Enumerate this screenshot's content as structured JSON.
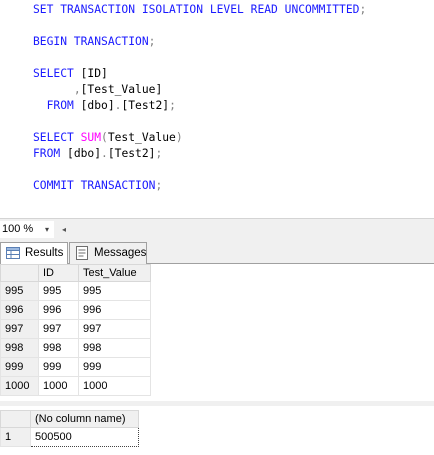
{
  "editor": {
    "lines": [
      [
        {
          "t": "kw",
          "v": "SET TRANSACTION ISOLATION LEVEL READ UNCOMMITTED"
        },
        {
          "t": "op",
          "v": ";"
        }
      ],
      [],
      [
        {
          "t": "kw",
          "v": "BEGIN TRANSACTION"
        },
        {
          "t": "op",
          "v": ";"
        }
      ],
      [],
      [
        {
          "t": "kw",
          "v": "SELECT "
        },
        {
          "t": "tx",
          "v": "[ID]"
        }
      ],
      [
        {
          "t": "tx",
          "v": "      "
        },
        {
          "t": "op",
          "v": ","
        },
        {
          "t": "tx",
          "v": "[Test_Value]"
        }
      ],
      [
        {
          "t": "tx",
          "v": "  "
        },
        {
          "t": "kw",
          "v": "FROM "
        },
        {
          "t": "tx",
          "v": "[dbo]"
        },
        {
          "t": "op",
          "v": "."
        },
        {
          "t": "tx",
          "v": "[Test2]"
        },
        {
          "t": "op",
          "v": ";"
        }
      ],
      [],
      [
        {
          "t": "kw",
          "v": "SELECT "
        },
        {
          "t": "fn",
          "v": "SUM"
        },
        {
          "t": "op",
          "v": "("
        },
        {
          "t": "tx",
          "v": "Test_Value"
        },
        {
          "t": "op",
          "v": ")"
        }
      ],
      [
        {
          "t": "kw",
          "v": "FROM "
        },
        {
          "t": "tx",
          "v": "[dbo]"
        },
        {
          "t": "op",
          "v": "."
        },
        {
          "t": "tx",
          "v": "[Test2]"
        },
        {
          "t": "op",
          "v": ";"
        }
      ],
      [],
      [
        {
          "t": "kw",
          "v": "COMMIT TRANSACTION"
        },
        {
          "t": "op",
          "v": ";"
        }
      ]
    ]
  },
  "zoom": {
    "value": "100 %",
    "arrow": "▾",
    "scroll_left": "◂"
  },
  "tabs": {
    "results": "Results",
    "messages": "Messages"
  },
  "grid1": {
    "headers": [
      "",
      "ID",
      "Test_Value"
    ],
    "rows": [
      [
        "995",
        "995",
        "995"
      ],
      [
        "996",
        "996",
        "996"
      ],
      [
        "997",
        "997",
        "997"
      ],
      [
        "998",
        "998",
        "998"
      ],
      [
        "999",
        "999",
        "999"
      ],
      [
        "1000",
        "1000",
        "1000"
      ]
    ]
  },
  "grid2": {
    "headers": [
      "",
      "(No column name)"
    ],
    "rows": [
      [
        "1",
        "500500"
      ]
    ]
  },
  "colors": {
    "keyword": "#1a1aff",
    "function": "#ff00ff",
    "operator": "#808080"
  }
}
